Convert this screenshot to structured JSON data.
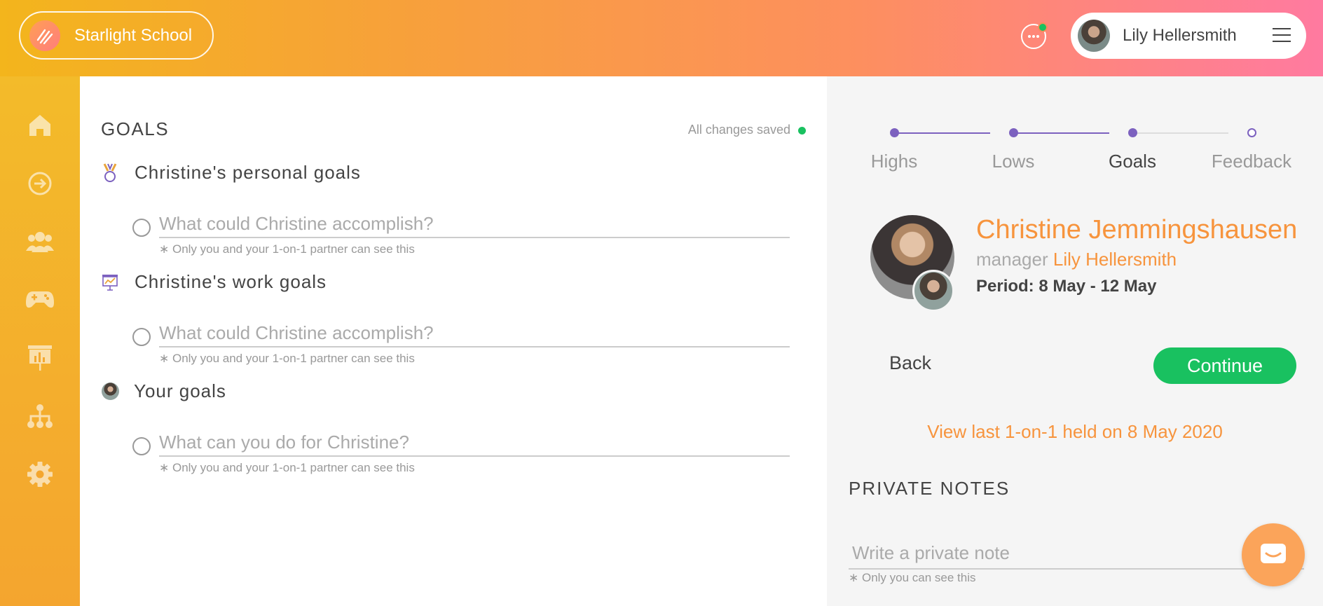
{
  "header": {
    "brand_name": "Starlight School",
    "user_name": "Lily Hellersmith"
  },
  "sidebar": {
    "items": [
      {
        "icon": "home-icon"
      },
      {
        "icon": "arrow-right-circle-icon"
      },
      {
        "icon": "team-icon"
      },
      {
        "icon": "gamepad-icon"
      },
      {
        "icon": "presentation-chart-icon"
      },
      {
        "icon": "org-chart-icon"
      },
      {
        "icon": "gear-icon"
      }
    ]
  },
  "main": {
    "title": "GOALS",
    "saved_status": "All changes saved",
    "sections": [
      {
        "icon": "medal-icon",
        "title": "Christine's personal goals",
        "placeholder": "What could Christine accomplish?",
        "note": "∗ Only you and your 1-on-1 partner can see this"
      },
      {
        "icon": "presentation-chart-icon",
        "title": "Christine's work goals",
        "placeholder": "What could Christine accomplish?",
        "note": "∗ Only you and your 1-on-1 partner can see this"
      },
      {
        "icon": "avatar",
        "title": "Your goals",
        "placeholder": "What can you do for Christine?",
        "note": "∗ Only you and your 1-on-1 partner can see this"
      }
    ]
  },
  "right": {
    "steps": [
      "Highs",
      "Lows",
      "Goals",
      "Feedback"
    ],
    "active_step": "Goals",
    "person_name": "Christine Jemmingshausen",
    "manager_prefix": "manager",
    "manager_name": "Lily Hellersmith",
    "period": "Period: 8 May - 12 May",
    "back_label": "Back",
    "continue_label": "Continue",
    "view_last_label": "View last 1-on-1 held on 8 May 2020",
    "private_title": "PRIVATE NOTES",
    "private_placeholder": "Write a private note",
    "private_note": "∗ Only you can see this"
  },
  "colors": {
    "accent_orange": "#f7943d",
    "continue_green": "#19c160",
    "step_purple": "#7c61bf"
  }
}
